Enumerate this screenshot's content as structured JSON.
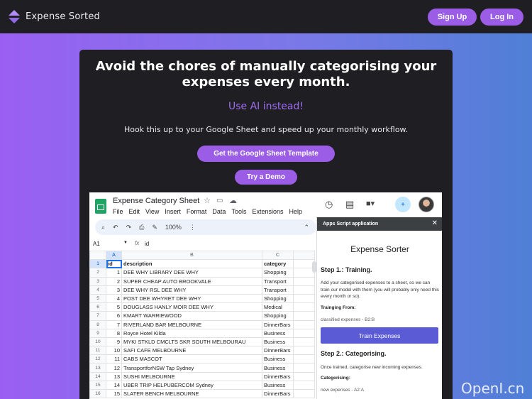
{
  "nav": {
    "brand": "Expense Sorted",
    "signup_label": "Sign Up",
    "login_label": "Log In"
  },
  "hero": {
    "title": "Avoid the chores of manually categorising your expenses every month.",
    "subtitle": "Use AI instead!",
    "text": "Hook this up to your Google Sheet and speed up your monthly workflow.",
    "cta_template": "Get the Google Sheet Template",
    "cta_demo": "Try a Demo"
  },
  "sheet": {
    "title": "Expense Category Sheet",
    "menu": [
      "File",
      "Edit",
      "View",
      "Insert",
      "Format",
      "Data",
      "Tools",
      "Extensions",
      "Help"
    ],
    "zoom": "100%",
    "cell_ref": "A1",
    "formula_value": "id",
    "fx": "fx",
    "columns": [
      "A",
      "B",
      "C"
    ],
    "header_row": [
      "id",
      "description",
      "category"
    ],
    "rows": [
      [
        "1",
        "DEE WHY LIBRARY DEE WHY",
        "Shopping"
      ],
      [
        "2",
        "SUPER CHEAP AUTO BROOKVALE",
        "Transport"
      ],
      [
        "3",
        "DEE WHY RSL DEE WHY",
        "Transport"
      ],
      [
        "4",
        "POST DEE WHYRET DEE WHY",
        "Shopping"
      ],
      [
        "5",
        "DOUGLASS HANLY MOIR DEE WHY",
        "Medical"
      ],
      [
        "6",
        "KMART WARRIEWOOD",
        "Shopping"
      ],
      [
        "7",
        "RIVERLAND BAR MELBOURNE",
        "DinnerBars"
      ],
      [
        "8",
        "Royce Hotel Kilda",
        "Business"
      ],
      [
        "9",
        "MYKI STKLD CMCLTS SKR SOUTH MELBOURAU",
        "Business"
      ],
      [
        "10",
        "SAFI CAFE MELBOURNE",
        "DinnerBars"
      ],
      [
        "11",
        "CABS MASCOT",
        "Business"
      ],
      [
        "12",
        "TransportforNSW Tap Sydney",
        "Business"
      ],
      [
        "13",
        "SUSHI MELBOURNE",
        "DinnerBars"
      ],
      [
        "14",
        "UBER TRIP HELPUBERCOM Sydney",
        "Business"
      ],
      [
        "15",
        "SLATER BENCH MELBOURNE",
        "DinnerBars"
      ]
    ]
  },
  "panel": {
    "header": "Apps Script application",
    "title": "Expense Sorter",
    "step1_heading": "Step 1.: Training.",
    "step1_text": "Add your categorised expenses to a sheet, so we can train our model with them (you will probably only need this every month or so).",
    "training_from_label": "Trainging From:",
    "training_from_value": "classified expenses - B2:B",
    "train_button": "Train Expenses",
    "step2_heading": "Step 2.: Categorising.",
    "step2_text": "Once trained, categorise new incoming expenses.",
    "categorising_label": "Categorising:",
    "categorising_value": "new expenses - A2:A"
  },
  "watermark": "OpenI.cn",
  "colors": {
    "accent": "#9b5de5",
    "nav_bg": "#1f1f23",
    "panel_button": "#5b5bd6"
  }
}
